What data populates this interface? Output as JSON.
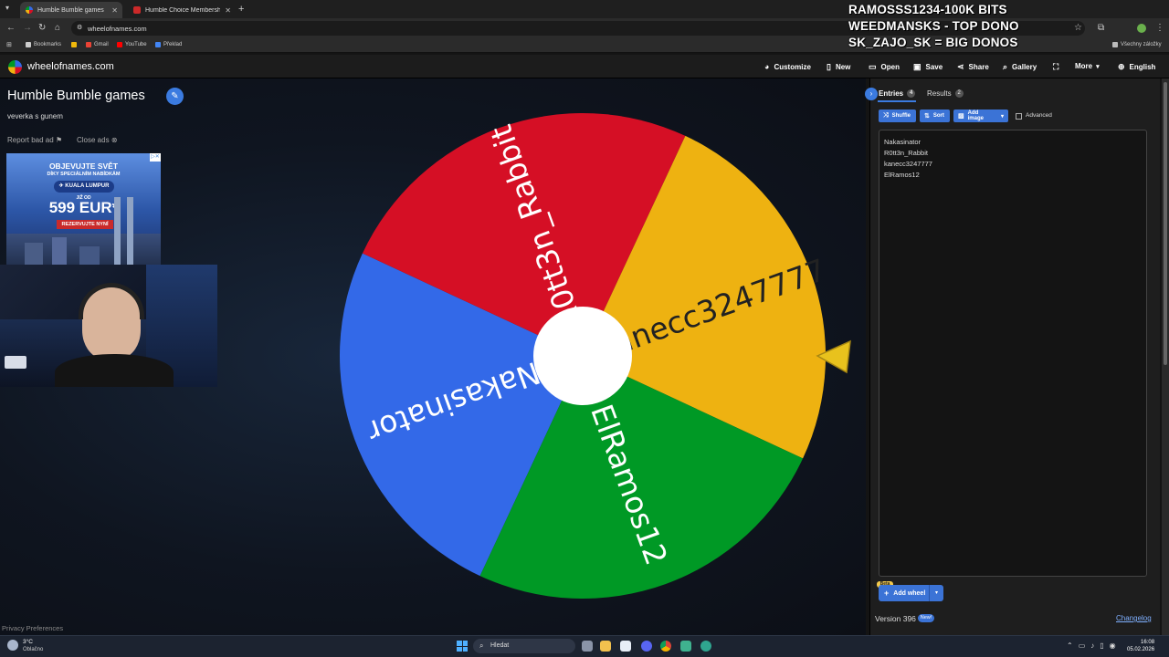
{
  "browser": {
    "tabs": [
      {
        "title": "Humble Bumble games",
        "active": true
      },
      {
        "title": "Humble Choice Membership M",
        "active": false
      }
    ],
    "url": "wheelofnames.com",
    "bookmarks": [
      "Bookmarks",
      "Gmail",
      "YouTube",
      "Překlad"
    ],
    "other_bookmarks": "Všechny záložky"
  },
  "stream_overlay": {
    "lines": [
      "RAMOSSS1234-100K BITS",
      "WEEDMANSKS - TOP DONO",
      "SK_ZAJO_SK = BIG DONOS"
    ]
  },
  "header": {
    "site_name": "wheelofnames.com",
    "menu": [
      {
        "label": "Customize",
        "icon": "palette-icon"
      },
      {
        "label": "New",
        "icon": "file-icon"
      },
      {
        "label": "Open",
        "icon": "folder-icon"
      },
      {
        "label": "Save",
        "icon": "save-icon"
      },
      {
        "label": "Share",
        "icon": "share-icon"
      },
      {
        "label": "Gallery",
        "icon": "search-icon"
      },
      {
        "label": "",
        "icon": "fullscreen-icon"
      },
      {
        "label": "More",
        "icon": "chevron-down-icon"
      },
      {
        "label": "English",
        "icon": "globe-icon"
      }
    ]
  },
  "wheel": {
    "title": "Humble Bumble games",
    "description": "veverka s gunem",
    "report_ad": "Report bad ad",
    "close_ads": "Close ads",
    "privacy": "Privacy Preferences",
    "segments": [
      {
        "name": "Nakasinator",
        "color": "#3369E8"
      },
      {
        "name": "R0tt3n_Rabbit",
        "color": "#D50F25"
      },
      {
        "name": "kanecc3247777",
        "color": "#EEB211"
      },
      {
        "name": "ElRamos12",
        "color": "#009925"
      }
    ]
  },
  "ad": {
    "line1": "OBJEVUJTE SVĚT",
    "line2": "DÍKY SPECIÁLNÍM NABÍDKÁM",
    "destination": "KUALA LUMPUR",
    "from": "JIŽ OD",
    "price": "599 EUR*",
    "cta": "REZERVUJTE NYNÍ"
  },
  "panel": {
    "tabs": [
      {
        "label": "Entries",
        "count": "4"
      },
      {
        "label": "Results",
        "count": "2"
      }
    ],
    "buttons": {
      "shuffle": "Shuffle",
      "sort": "Sort",
      "add_image": "Add image",
      "advanced": "Advanced"
    },
    "entries": [
      "Nakasinator",
      "R0tt3n_Rabbit",
      "kanecc3247777",
      "ElRamos12"
    ],
    "beta": "Beta",
    "add_wheel": "Add wheel",
    "version": "Version 396",
    "new_badge": "New!",
    "changelog": "Changelog"
  },
  "taskbar": {
    "temperature": "3°C",
    "weather": "Oblačno",
    "search_placeholder": "Hledat",
    "time": "16:08",
    "date": "05.02.2026"
  },
  "colors": {
    "accent": "#3B73D6",
    "wheel_blue": "#3369E8",
    "wheel_red": "#D50F25",
    "wheel_yellow": "#EEB211",
    "wheel_green": "#009925"
  }
}
